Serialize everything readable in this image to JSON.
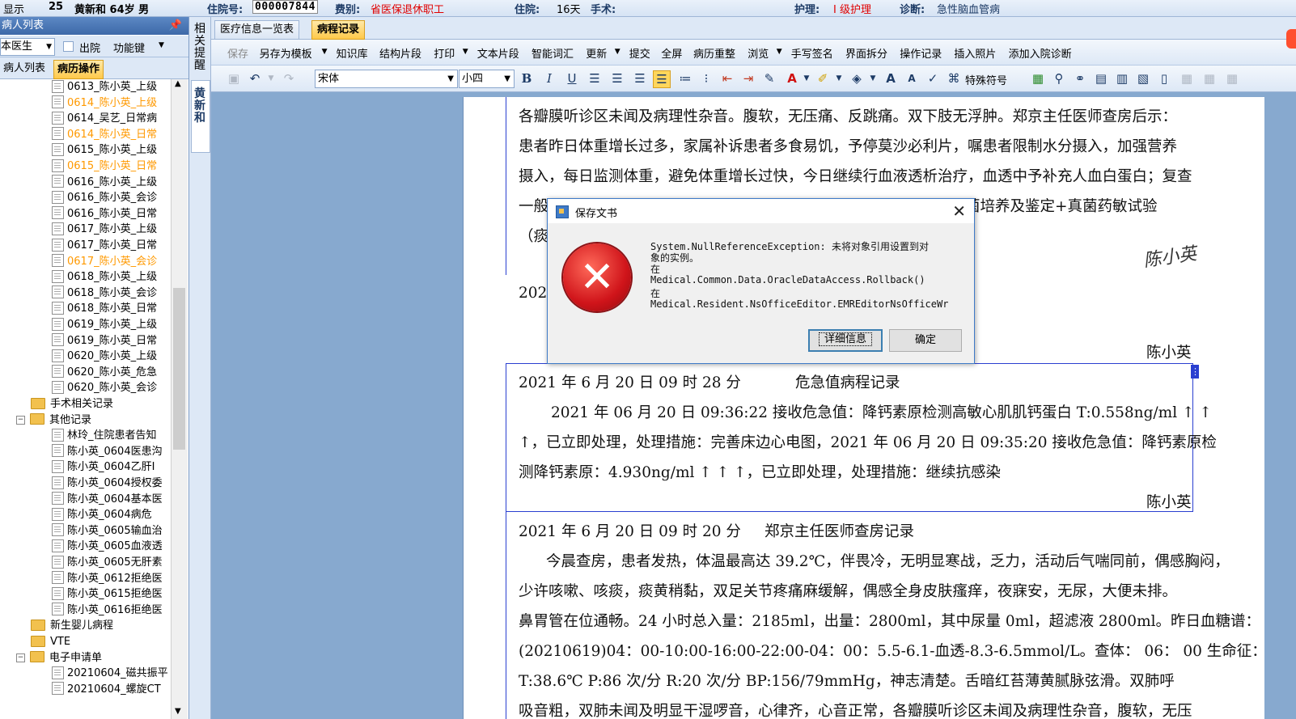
{
  "patient_bar": {
    "show_label": "显示",
    "bed_no": "25",
    "patient": "黄新和 64岁 男",
    "admission_no_label": "住院号:",
    "admission_no": "000007844",
    "category_label": "费别:",
    "category": "省医保退休职工",
    "stay_label": "住院:",
    "stay": "16天",
    "surgery_label": "手术:",
    "nursing_label": "护理:",
    "nursing": "I 级护理",
    "diagnosis_label": "诊断:",
    "diagnosis": "急性脑血管病"
  },
  "left_panel": {
    "title": "病人列表",
    "pin": "ᵠ",
    "doctor_combo": "本医生",
    "discharged_label": "出院",
    "function_key": "功能键",
    "tab_patients": "病人列表",
    "tab_records": "病历操作",
    "tree": [
      {
        "text": "0613_陈小英_上级",
        "level": 3,
        "type": "doc",
        "color": "normal"
      },
      {
        "text": "0614_陈小英_上级",
        "level": 3,
        "type": "doc",
        "color": "orange"
      },
      {
        "text": "0614_吴艺_日常病",
        "level": 3,
        "type": "doc",
        "color": "normal"
      },
      {
        "text": "0614_陈小英_日常",
        "level": 3,
        "type": "doc",
        "color": "orange"
      },
      {
        "text": "0615_陈小英_上级",
        "level": 3,
        "type": "doc",
        "color": "normal"
      },
      {
        "text": "0615_陈小英_日常",
        "level": 3,
        "type": "doc",
        "color": "orange"
      },
      {
        "text": "0616_陈小英_上级",
        "level": 3,
        "type": "doc",
        "color": "normal"
      },
      {
        "text": "0616_陈小英_会诊",
        "level": 3,
        "type": "doc",
        "color": "normal"
      },
      {
        "text": "0616_陈小英_日常",
        "level": 3,
        "type": "doc",
        "color": "normal"
      },
      {
        "text": "0617_陈小英_上级",
        "level": 3,
        "type": "doc",
        "color": "normal"
      },
      {
        "text": "0617_陈小英_日常",
        "level": 3,
        "type": "doc",
        "color": "normal"
      },
      {
        "text": "0617_陈小英_会诊",
        "level": 3,
        "type": "doc",
        "color": "orange"
      },
      {
        "text": "0618_陈小英_上级",
        "level": 3,
        "type": "doc",
        "color": "normal"
      },
      {
        "text": "0618_陈小英_会诊",
        "level": 3,
        "type": "doc",
        "color": "normal"
      },
      {
        "text": "0618_陈小英_日常",
        "level": 3,
        "type": "doc",
        "color": "normal"
      },
      {
        "text": "0619_陈小英_上级",
        "level": 3,
        "type": "doc",
        "color": "normal"
      },
      {
        "text": "0619_陈小英_日常",
        "level": 3,
        "type": "doc",
        "color": "normal"
      },
      {
        "text": "0620_陈小英_上级",
        "level": 3,
        "type": "doc",
        "color": "normal"
      },
      {
        "text": "0620_陈小英_危急",
        "level": 3,
        "type": "doc",
        "color": "normal"
      },
      {
        "text": "0620_陈小英_会诊",
        "level": 3,
        "type": "doc",
        "color": "normal"
      },
      {
        "text": "手术相关记录",
        "level": 2,
        "type": "folder",
        "color": "normal"
      },
      {
        "text": "其他记录",
        "level": 1,
        "type": "folder-open",
        "color": "normal"
      },
      {
        "text": "林玲_住院患者告知",
        "level": 3,
        "type": "doc",
        "color": "normal"
      },
      {
        "text": "陈小英_0604医患沟",
        "level": 3,
        "type": "doc",
        "color": "normal"
      },
      {
        "text": "陈小英_0604乙肝Ⅰ",
        "level": 3,
        "type": "doc",
        "color": "normal"
      },
      {
        "text": "陈小英_0604授权委",
        "level": 3,
        "type": "doc",
        "color": "normal"
      },
      {
        "text": "陈小英_0604基本医",
        "level": 3,
        "type": "doc",
        "color": "normal"
      },
      {
        "text": "陈小英_0604病危",
        "level": 3,
        "type": "doc",
        "color": "normal"
      },
      {
        "text": "陈小英_0605输血治",
        "level": 3,
        "type": "doc",
        "color": "normal"
      },
      {
        "text": "陈小英_0605血液透",
        "level": 3,
        "type": "doc",
        "color": "normal"
      },
      {
        "text": "陈小英_0605无肝素",
        "level": 3,
        "type": "doc",
        "color": "normal"
      },
      {
        "text": "陈小英_0612拒绝医",
        "level": 3,
        "type": "doc",
        "color": "normal"
      },
      {
        "text": "陈小英_0615拒绝医",
        "level": 3,
        "type": "doc",
        "color": "normal"
      },
      {
        "text": "陈小英_0616拒绝医",
        "level": 3,
        "type": "doc",
        "color": "normal"
      },
      {
        "text": "新生婴儿病程",
        "level": 2,
        "type": "folder",
        "color": "normal"
      },
      {
        "text": "VTE",
        "level": 2,
        "type": "folder",
        "color": "normal"
      },
      {
        "text": "电子申请单",
        "level": 1,
        "type": "folder-open",
        "color": "normal"
      },
      {
        "text": "20210604_磁共振平",
        "level": 3,
        "type": "doc",
        "color": "normal"
      },
      {
        "text": "20210604_螺旋CT",
        "level": 3,
        "type": "doc",
        "color": "normal"
      }
    ]
  },
  "vertical_strip": {
    "related": "相关提醒",
    "patient": "黄新和"
  },
  "main_tabs": {
    "info": "医疗信息一览表",
    "record": "病程记录"
  },
  "toolbar1": [
    {
      "label": "保存",
      "disabled": true,
      "dropdown": false
    },
    {
      "label": "另存为模板",
      "disabled": false,
      "dropdown": true
    },
    {
      "label": "知识库",
      "disabled": false,
      "dropdown": false
    },
    {
      "label": "结构片段",
      "disabled": false,
      "dropdown": false
    },
    {
      "label": "打印",
      "disabled": false,
      "dropdown": true
    },
    {
      "label": "文本片段",
      "disabled": false,
      "dropdown": false
    },
    {
      "label": "智能词汇",
      "disabled": false,
      "dropdown": false
    },
    {
      "label": "更新",
      "disabled": false,
      "dropdown": true
    },
    {
      "label": "提交",
      "disabled": false,
      "dropdown": false
    },
    {
      "label": "全屏",
      "disabled": false,
      "dropdown": false
    },
    {
      "label": "病历重整",
      "disabled": false,
      "dropdown": false
    },
    {
      "label": "浏览",
      "disabled": false,
      "dropdown": true
    },
    {
      "label": "手写签名",
      "disabled": false,
      "dropdown": false
    },
    {
      "label": "界面拆分",
      "disabled": false,
      "dropdown": false
    },
    {
      "label": "操作记录",
      "disabled": false,
      "dropdown": false
    },
    {
      "label": "插入照片",
      "disabled": false,
      "dropdown": false
    },
    {
      "label": "添加入院诊断",
      "disabled": false,
      "dropdown": false
    }
  ],
  "toolbar2": {
    "font": "宋体",
    "size": "小四",
    "special_symbols": "特殊符号"
  },
  "document": {
    "lines_top": [
      "各瓣膜听诊区未闻及病理性杂音。腹软，无压痛、反跳痛。双下肢无浮肿。郑京主任医师查房后示：",
      "患者昨日体重增长过多，家属补诉患者多食易饥，予停莫沙必利片，嘱患者限制水分摄入，加强营养",
      "摄入，每日监测体重，避免体重增长过快，今日继续行血液透析治疗，血透中予补充人血白蛋白；复查",
      "一般",
      "（痰"
    ],
    "partial_right": "菌培养及鉴定+真菌药敏试验",
    "date_stub": "2021",
    "signature_1": "陈小英",
    "handwritten_sig": "陈小英",
    "critical_header_time": "2021 年 6 月 20 日 09 时 28 分",
    "critical_header_title": "危急值病程记录",
    "critical_lines": [
      "2021 年 06 月 20 日  09:36:22 接收危急值：降钙素原检测高敏心肌肌钙蛋白 T:0.558ng/ml ↑ ↑",
      "↑，已立即处理，处理措施：完善床边心电图，2021 年 06 月 20 日  09:35:20 接收危急值：降钙素原检",
      "测降钙素原：4.930ng/ml ↑ ↑ ↑，已立即处理，处理措施：继续抗感染"
    ],
    "signature_2": "陈小英",
    "round_header_time": "2021 年 6 月 20 日 09 时 20 分",
    "round_header_title": "郑京主任医师查房记录",
    "round_lines": [
      "今晨查房，患者发热，体温最高达 39.2℃，伴畏冷，无明显寒战，乏力，活动后气喘同前，偶感胸闷，",
      "少许咳嗽、咳痰，痰黄稍黏，双足关节疼痛麻缓解，偶感全身皮肤瘙痒，夜寐安，无尿，大便未排。",
      "鼻胃管在位通畅。24 小时总入量：2185ml，出量：2800ml，其中尿量 0ml，超滤液 2800ml。昨日血糖谱：",
      "(20210619)04：00-10:00-16:00-22:00-04：00：5.5-6.1-血透-8.3-6.5mmol/L。查体：  06：  00 生命征：",
      "T:38.6℃      P:86 次/分      R:20 次/分    BP:156/79mmHg，神志清楚。舌暗红苔薄黄腻脉弦滑。双肺呼",
      "吸音粗，双肺未闻及明显干湿啰音，心律齐，心音正常，各瓣膜听诊区未闻及病理性杂音，腹软，无压"
    ]
  },
  "dialog": {
    "title": "保存文书",
    "message_lines": [
      "System.NullReferenceException: 未将对象引用设置到对",
      "象的实例。",
      "   在",
      "Medical.Common.Data.OracleDataAccess.Rollback()",
      "   在",
      "Medical.Resident.NsOfficeEditor.EMREditorNsOfficeWr"
    ],
    "details_button": "详细信息",
    "ok_button": "确定"
  }
}
